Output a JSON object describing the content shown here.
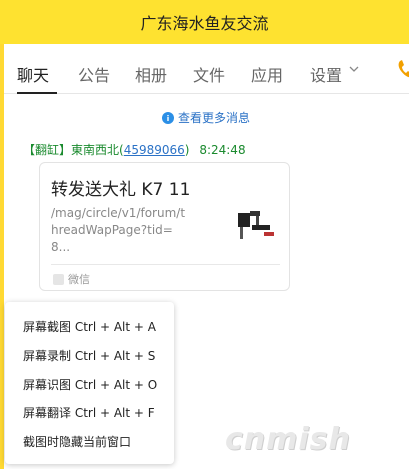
{
  "window": {
    "title": "广东海水鱼友交流"
  },
  "tabs": [
    {
      "label": "聊天"
    },
    {
      "label": "公告"
    },
    {
      "label": "相册"
    },
    {
      "label": "文件"
    },
    {
      "label": "应用"
    },
    {
      "label": "设置"
    }
  ],
  "chat": {
    "view_more": "查看更多消息",
    "message": {
      "tag": "【翻缸】",
      "sender": "東南西北",
      "qq_open": "(",
      "qq": "45989066",
      "qq_close": ")",
      "time": "8:24:48",
      "card": {
        "title": "转发送大礼 K7 11",
        "url": "/mag/circle/v1/forum/threadWapPage?tid=8...",
        "source": "微信"
      }
    }
  },
  "context_menu": {
    "items": [
      "屏幕截图 Ctrl + Alt + A",
      "屏幕录制 Ctrl + Alt + S",
      "屏幕识图 Ctrl + Alt + O",
      "屏幕翻译 Ctrl + Alt + F",
      "截图时隐藏当前窗口"
    ]
  },
  "watermark": "cnmish",
  "colors": {
    "title_bar": "#fee230",
    "link_blue": "#2b72c6",
    "sender_green": "#1a8a2e"
  },
  "icons": [
    "info-icon",
    "chevron-down-icon",
    "phone-icon"
  ]
}
